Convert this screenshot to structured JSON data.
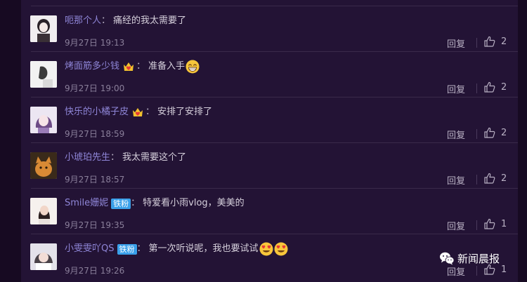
{
  "comments": [
    {
      "username": "呃那个人",
      "text": "痛经的我太需要了",
      "time": "9月27日 19:13",
      "reply": "回复",
      "likes": "2",
      "avatar_icon": "avatar-girl-sketch-icon"
    },
    {
      "username": "烤面筋多少钱",
      "text": "准备入手",
      "time": "9月27日 19:00",
      "reply": "回复",
      "likes": "2",
      "avatar_icon": "avatar-photo-icon",
      "crown_icon": "crown-heart-icon",
      "emoji": "grinning-emoji"
    },
    {
      "username": "快乐的小橘子皮",
      "text": "安排了安排了",
      "time": "9月27日 18:59",
      "reply": "回复",
      "likes": "2",
      "avatar_icon": "avatar-anime-icon",
      "crown_icon": "crown-heart-icon"
    },
    {
      "username": "小琥珀先生",
      "text": "我太需要这个了",
      "time": "9月27日 18:57",
      "reply": "回复",
      "likes": "2",
      "avatar_icon": "avatar-cat-icon"
    },
    {
      "username": "Smile姗妮",
      "badge": "铁粉",
      "text": "特爱看小雨vlog，美美的",
      "time": "9月27日 19:35",
      "reply": "回复",
      "likes": "1",
      "avatar_icon": "avatar-girl-icon"
    },
    {
      "username": "小雯雯吖QS",
      "badge": "铁粉",
      "text": "第一次听说呢，我也要试试",
      "time": "9月27日 19:26",
      "reply": "回复",
      "likes": "1",
      "avatar_icon": "avatar-girl-photo-icon",
      "emoji": "heart-eyes-emoji"
    }
  ],
  "colon": "：",
  "watermark": {
    "label": "新闻晨报",
    "icon": "wechat-icon"
  },
  "colors": {
    "username": "#8f86d8",
    "badge": "#3aa0ea",
    "background": "#231335"
  }
}
